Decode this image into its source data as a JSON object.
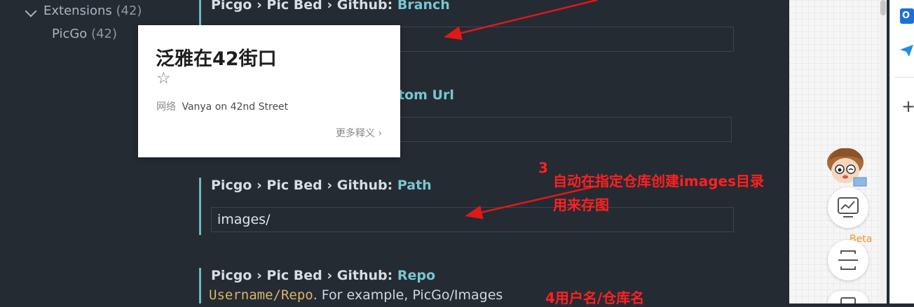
{
  "sidebar": {
    "extensions_label": "Extensions",
    "extensions_count": "(42)",
    "picgo_label": "PicGo",
    "picgo_count": "(42)"
  },
  "settings": {
    "branch": {
      "prefix": "Picgo › Pic Bed › Github: ",
      "name": "Branch"
    },
    "custom_url": {
      "name": "tom Url"
    },
    "path": {
      "prefix": "Picgo › Pic Bed › Github: ",
      "name": "Path",
      "value": "images/"
    },
    "repo": {
      "prefix": "Picgo › Pic Bed › Github: ",
      "name": "Repo",
      "desc_code": "Username/Repo",
      "desc_text": ". For example, PicGo/Images"
    }
  },
  "dictionary_popup": {
    "word": "泛雅在42街口",
    "star_icon": "star-outline-icon",
    "tag": "网络",
    "definition": "Vanya on 42nd Street",
    "more": "更多释义 ›"
  },
  "annotations": {
    "step3_number": "3",
    "step3_line1": "自动在指定仓库创建images目录",
    "step3_line2": "用来存图",
    "step4": "4用户名/仓库名"
  },
  "right_panel": {
    "beta_label": "Beta",
    "outlook_letter": "O"
  },
  "colors": {
    "editor_bg": "#252b33",
    "accent": "#78c6cf",
    "annotation": "#ff2020",
    "code": "#d7b46a"
  }
}
